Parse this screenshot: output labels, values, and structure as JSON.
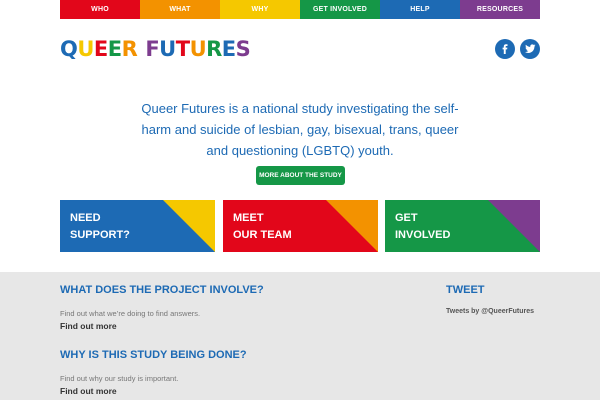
{
  "nav": {
    "items": [
      {
        "label": "WHO",
        "color": "#e2061a"
      },
      {
        "label": "WHAT",
        "color": "#f39200"
      },
      {
        "label": "WHY",
        "color": "#f5c800"
      },
      {
        "label": "GET INVOLVED",
        "color": "#159747"
      },
      {
        "label": "HELP",
        "color": "#1d6ab4"
      },
      {
        "label": "RESOURCES",
        "color": "#7d3c8f"
      }
    ]
  },
  "logo": {
    "text": "QUEER FUTURES",
    "letter_colors": [
      "#1d6ab4",
      "#f5c800",
      "#e2061a",
      "#159747",
      "#f39200",
      "#7d3c8f",
      "#1d6ab4",
      "#e2061a",
      "#f39200",
      "#159747",
      "#1d6ab4",
      "#7d3c8f"
    ]
  },
  "social": {
    "facebook_icon": "facebook-icon",
    "twitter_icon": "twitter-icon",
    "color": "#1d6ab4"
  },
  "intro": {
    "line1": "Queer Futures is a national study investigating the self-",
    "line2": "harm and suicide of lesbian, gay, bisexual, trans, queer",
    "line3": "and questioning (LGBTQ) youth."
  },
  "more_button": {
    "label": "MORE ABOUT THE STUDY"
  },
  "tiles": [
    {
      "line1": "NEED",
      "line2": "SUPPORT?",
      "color": "#1d6ab4",
      "accent": "#f5c800"
    },
    {
      "line1": "MEET",
      "line2": "OUR TEAM",
      "color": "#e2061a",
      "accent": "#f39200"
    },
    {
      "line1": "GET",
      "line2": "INVOLVED",
      "color": "#159747",
      "accent": "#7d3c8f"
    }
  ],
  "sections": [
    {
      "heading": "WHAT DOES THE PROJECT INVOLVE?",
      "text": "Find out what we’re doing to find answers.",
      "link": "Find out more"
    },
    {
      "heading": "WHY IS THIS STUDY BEING DONE?",
      "text": "Find out why our study is important.",
      "link": "Find out more"
    }
  ],
  "tweets": {
    "heading": "TWEET",
    "by": "Tweets by @QueerFutures"
  }
}
